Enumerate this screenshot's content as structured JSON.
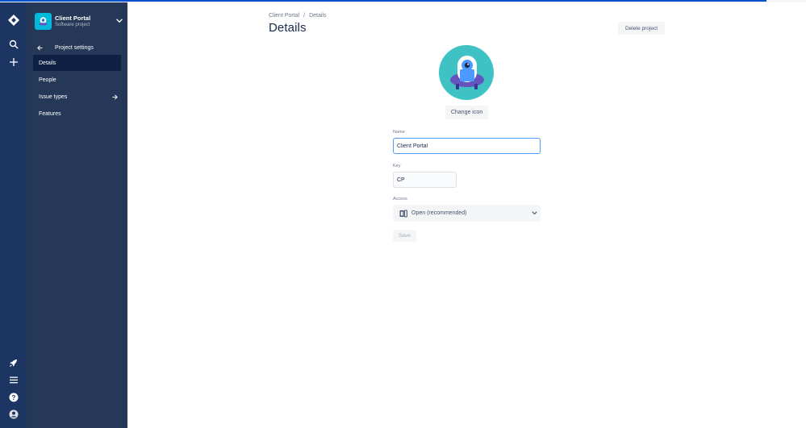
{
  "project": {
    "name": "Client Portal",
    "type": "Software project"
  },
  "sidebar": {
    "back_label": "Project settings",
    "items": [
      {
        "label": "Details",
        "active": true
      },
      {
        "label": "People",
        "active": false
      },
      {
        "label": "Issue types",
        "active": false
      },
      {
        "label": "Features",
        "active": false
      }
    ]
  },
  "breadcrumb": {
    "items": [
      "Client Portal",
      "Details"
    ],
    "separator": "/"
  },
  "page": {
    "title": "Details",
    "delete_label": "Delete project",
    "change_icon_label": "Change icon"
  },
  "form": {
    "name_label": "Name",
    "name_value": "Client Portal",
    "key_label": "Key",
    "key_value": "CP",
    "access_label": "Access",
    "access_value": "Open (recommended)",
    "save_label": "Save"
  },
  "colors": {
    "global_nav": "#1c3563",
    "project_nav": "#253858",
    "accent": "#4c9aff",
    "avatar_bg": "#00b8d9"
  },
  "icons": {
    "logo": "jira-diamond-icon",
    "search": "search-icon",
    "create": "plus-icon",
    "whats_new": "rocket-icon",
    "menu": "menu-icon",
    "help": "help-icon",
    "profile": "avatar-icon"
  }
}
